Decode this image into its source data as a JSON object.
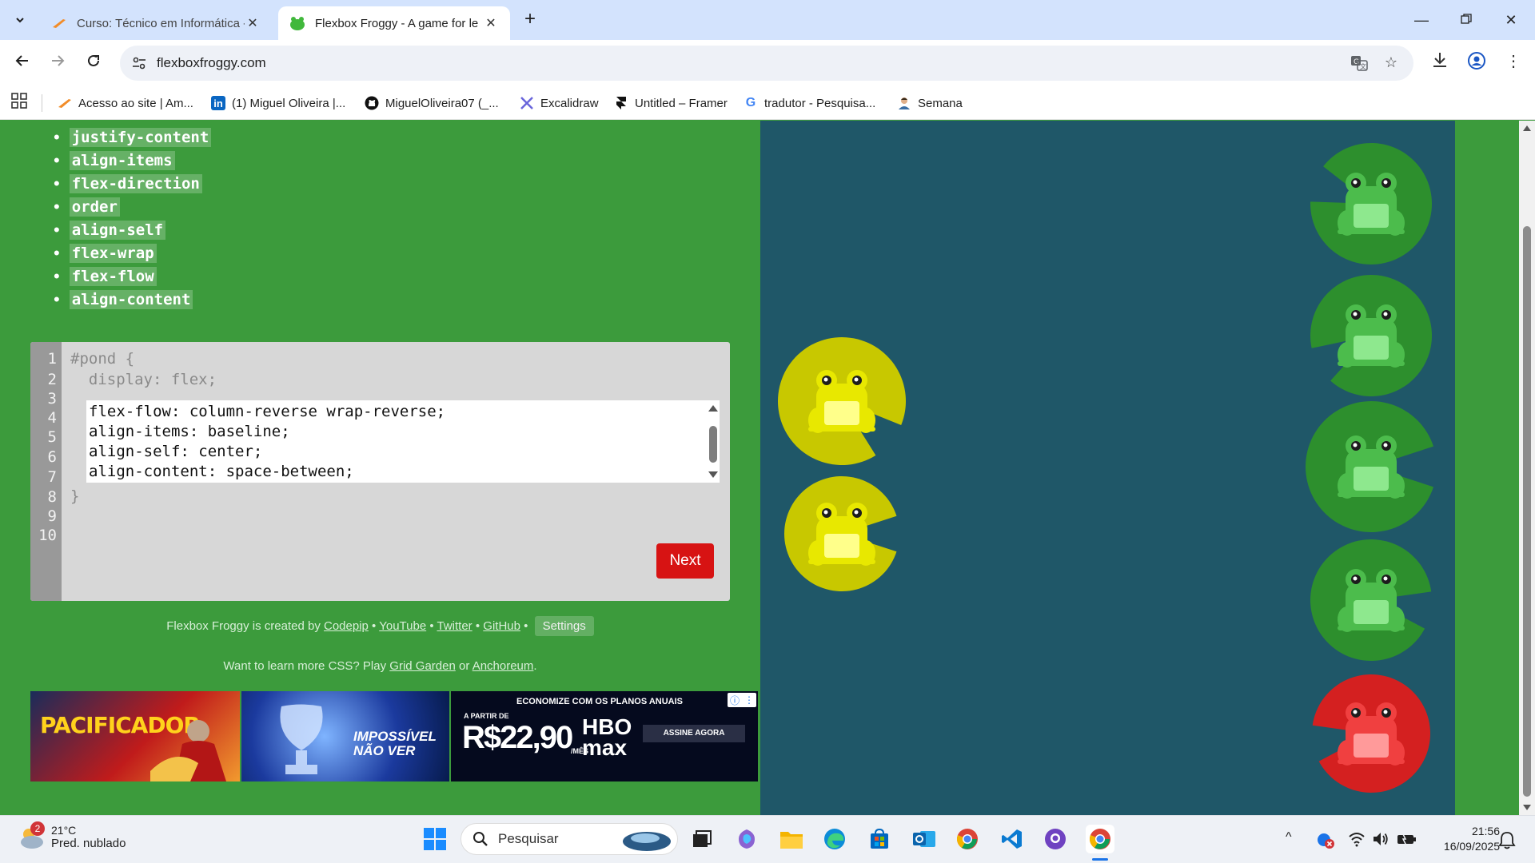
{
  "browser": {
    "tabs": [
      {
        "title": "Curso: Técnico em Informática -",
        "active": false
      },
      {
        "title": "Flexbox Froggy - A game for le",
        "active": true
      }
    ],
    "url": "flexboxfroggy.com",
    "bookmarks": [
      {
        "label": "Acesso ao site | Am...",
        "icon": "orange-arrow-icon"
      },
      {
        "label": "(1) Miguel Oliveira |...",
        "icon": "linkedin-icon"
      },
      {
        "label": "MiguelOliveira07 (_...",
        "icon": "github-icon"
      },
      {
        "label": "Excalidraw",
        "icon": "excalidraw-icon"
      },
      {
        "label": "Untitled – Framer",
        "icon": "framer-icon"
      },
      {
        "label": "tradutor - Pesquisa...",
        "icon": "google-icon"
      },
      {
        "label": "Semana",
        "icon": "person-icon"
      }
    ]
  },
  "sidebar": {
    "properties": [
      "justify-content",
      "align-items",
      "flex-direction",
      "order",
      "align-self",
      "flex-wrap",
      "flex-flow",
      "align-content"
    ]
  },
  "editor": {
    "line_numbers": [
      "1",
      "2",
      "3",
      "4",
      "5",
      "6",
      "7",
      "8",
      "9",
      "10"
    ],
    "line1": "#pond {",
    "line2": "  display: flex;",
    "input_lines": [
      "flex-flow: column-reverse wrap-reverse;",
      "align-items: baseline;",
      "align-self: center;",
      "align-content: space-between;"
    ],
    "closing": "}",
    "next_label": "Next"
  },
  "credits": {
    "prefix": "Flexbox Froggy is created by",
    "codepip": "Codepip",
    "youtube": "YouTube",
    "twitter": "Twitter",
    "github": "GitHub",
    "settings": "Settings",
    "learn_prefix": "Want to learn more CSS? Play",
    "grid_garden": "Grid Garden",
    "or": "or",
    "anchoreum": "Anchoreum",
    "period": "."
  },
  "ad": {
    "panel1": "PACIFICADOR",
    "panel2": "IMPOSSÍVEL NÃO VER",
    "panel3_top": "ECONOMIZE COM OS PLANOS ANUAIS",
    "panel3_from": "A PARTIR DE",
    "panel3_price": "R$22,90",
    "panel3_per": "/MÊS",
    "panel3_brand": "HBO max",
    "panel3_cta": "ASSINE AGORA"
  },
  "pond": {
    "frogs": [
      {
        "color": "yellow",
        "pad": "yellow"
      },
      {
        "color": "yellow",
        "pad": "yellow"
      },
      {
        "color": "green",
        "pad": "green"
      },
      {
        "color": "green",
        "pad": "green"
      },
      {
        "color": "green",
        "pad": "green"
      },
      {
        "color": "green",
        "pad": "green"
      },
      {
        "color": "red",
        "pad": "red"
      }
    ],
    "colors": {
      "pond": "#1f5768",
      "green_pad": "#2d8f2d",
      "yellow_pad": "#c8c800",
      "red_pad": "#d42020"
    }
  },
  "taskbar": {
    "weather_badge": "2",
    "temp": "21°C",
    "condition": "Pred. nublado",
    "search_placeholder": "Pesquisar",
    "time": "21:56",
    "date": "16/09/2025"
  }
}
